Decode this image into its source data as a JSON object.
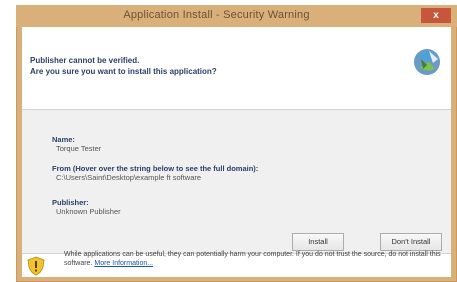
{
  "window": {
    "title": "Application Install - Security Warning",
    "close_label": "x"
  },
  "header": {
    "line1": "Publisher cannot be verified.",
    "line2": "Are you sure you want to install this application?"
  },
  "details": {
    "name_label": "Name:",
    "name_value": "Torque Tester",
    "from_label": "From (Hover over the string below to see the full domain):",
    "from_value": "C:\\Users\\Saint\\Desktop\\example ft software",
    "publisher_label": "Publisher:",
    "publisher_value": "Unknown Publisher"
  },
  "buttons": {
    "install": "Install",
    "dont_install": "Don't Install"
  },
  "footer": {
    "warning_text": "While applications can be useful, they can potentially harm your computer. If you do not trust the source, do not install this software.",
    "more_info": "More Information..."
  },
  "icons": {
    "app_icon": "clickonce-install-icon",
    "warning_icon": "shield-warning-icon"
  },
  "colors": {
    "frame": "#d9b07a",
    "close_button": "#c7573c",
    "heading_text": "#2a3f66",
    "link": "#1a55b0",
    "details_background": "#f0f0f0"
  }
}
